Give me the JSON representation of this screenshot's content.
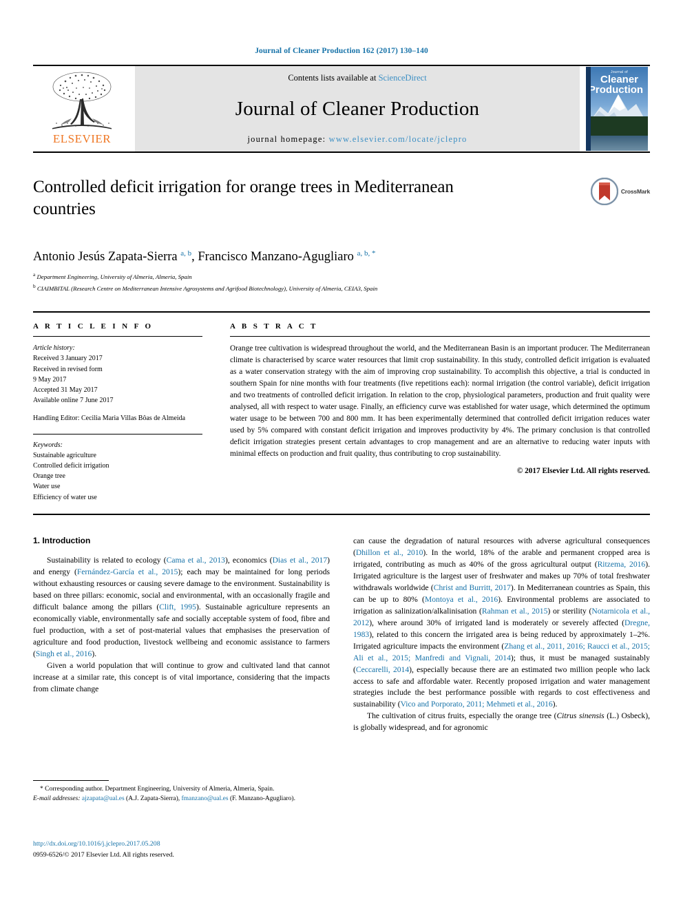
{
  "running_head": "Journal of Cleaner Production 162 (2017) 130–140",
  "masthead": {
    "publisher": "ELSEVIER",
    "contents_prefix": "Contents lists available at ",
    "contents_link": "ScienceDirect",
    "journal_name": "Journal of Cleaner Production",
    "homepage_prefix": "journal homepage: ",
    "homepage_url": "www.elsevier.com/locate/jclepro",
    "cover": {
      "line1": "Journal of",
      "line2": "Cleaner",
      "line3": "Production"
    }
  },
  "article": {
    "title": "Controlled deficit irrigation for orange trees in Mediterranean countries",
    "crossmark_label": "CrossMark",
    "authors_html": "Antonio Jesús Zapata-Sierra <sup>a, b</sup>, Francisco Manzano-Agugliaro <sup>a, b, *</sup>",
    "affiliations": [
      {
        "marker": "a",
        "text": "Department Engineering, University of Almeria, Almeria, Spain"
      },
      {
        "marker": "b",
        "text": "CIAIMBITAL (Research Centre on Mediterranean Intensive Agrosystems and Agrifood Biotechnology), University of Almeria, CEIA3, Spain"
      }
    ]
  },
  "info": {
    "heading": "A R T I C L E  I N F O",
    "history_label": "Article history:",
    "history": [
      "Received 3 January 2017",
      "Received in revised form",
      "9 May 2017",
      "Accepted 31 May 2017",
      "Available online 7 June 2017"
    ],
    "handling_editor": "Handling Editor: Cecilia Maria Villas Bôas de Almeida",
    "keywords_label": "Keywords:",
    "keywords": [
      "Sustainable agriculture",
      "Controlled deficit irrigation",
      "Orange tree",
      "Water use",
      "Efficiency of water use"
    ]
  },
  "abstract": {
    "heading": "A B S T R A C T",
    "text": "Orange tree cultivation is widespread throughout the world, and the Mediterranean Basin is an important producer. The Mediterranean climate is characterised by scarce water resources that limit crop sustainability. In this study, controlled deficit irrigation is evaluated as a water conservation strategy with the aim of improving crop sustainability. To accomplish this objective, a trial is conducted in southern Spain for nine months with four treatments (five repetitions each): normal irrigation (the control variable), deficit irrigation and two treatments of controlled deficit irrigation. In relation to the crop, physiological parameters, production and fruit quality were analysed, all with respect to water usage. Finally, an efficiency curve was established for water usage, which determined the optimum water usage to be between 700 and 800 mm. It has been experimentally determined that controlled deficit irrigation reduces water used by 5% compared with constant deficit irrigation and improves productivity by 4%. The primary conclusion is that controlled deficit irrigation strategies present certain advantages to crop management and are an alternative to reducing water inputs with minimal effects on production and fruit quality, thus contributing to crop sustainability.",
    "copyright": "© 2017 Elsevier Ltd. All rights reserved."
  },
  "introduction": {
    "heading": "1. Introduction",
    "left_paragraphs": [
      "Sustainability is related to ecology (<a class=\"cit\">Cama et al., 2013</a>), economics (<a class=\"cit\">Dias et al., 2017</a>) and energy (<a class=\"cit\">Fernández-García et al., 2015</a>); each may be maintained for long periods without exhausting resources or causing severe damage to the environment. Sustainability is based on three pillars: economic, social and environmental, with an occasionally fragile and difficult balance among the pillars (<a class=\"cit\">Clift, 1995</a>). Sustainable agriculture represents an economically viable, environmentally safe and socially acceptable system of food, fibre and fuel production, with a set of post-material values that emphasises the preservation of agriculture and food production, livestock wellbeing and economic assistance to farmers (<a class=\"cit\">Singh et al., 2016</a>).",
      "Given a world population that will continue to grow and cultivated land that cannot increase at a similar rate, this concept is of vital importance, considering that the impacts from climate change"
    ],
    "right_paragraphs": [
      "can cause the degradation of natural resources with adverse agricultural consequences (<a class=\"cit\">Dhillon et al., 2010</a>). In the world, 18% of the arable and permanent cropped area is irrigated, contributing as much as 40% of the gross agricultural output (<a class=\"cit\">Ritzema, 2016</a>). Irrigated agriculture is the largest user of freshwater and makes up 70% of total freshwater withdrawals worldwide (<a class=\"cit\">Christ and Burritt, 2017</a>). In Mediterranean countries as Spain, this can be up to 80% (<a class=\"cit\">Montoya et al., 2016</a>). Environmental problems are associated to irrigation as salinization/alkalinisation (<a class=\"cit\">Rahman et al., 2015</a>) or sterility (<a class=\"cit\">Notarnicola et al., 2012</a>), where around 30% of irrigated land is moderately or severely affected (<a class=\"cit\">Dregne, 1983</a>), related to this concern the irrigated area is being reduced by approximately 1–2%. Irrigated agriculture impacts the environment (<a class=\"cit\">Zhang et al., 2011, 2016; Raucci et al., 2015; Ali et al., 2015; Manfredi and Vignali, 2014</a>); thus, it must be managed sustainably (<a class=\"cit\">Ceccarelli, 2014</a>), especially because there are an estimated two million people who lack access to safe and affordable water. Recently proposed irrigation and water management strategies include the best performance possible with regards to cost effectiveness and sustainability (<a class=\"cit\">Vico and Porporato, 2011; Mehmeti et al., 2016</a>).",
      "The cultivation of citrus fruits, especially the orange tree (<i>Citrus sinensis</i> (L.) Osbeck), is globally widespread, and for agronomic"
    ]
  },
  "footnotes": {
    "corresponding": "* Corresponding author. Department Engineering, University of Almeria, Almeria, Spain.",
    "email_label": "E-mail addresses:",
    "email1": "ajzapata@ual.es",
    "email1_owner": "(A.J. Zapata-Sierra),",
    "email2": "fmanzano@ual.es",
    "email2_owner": "(F. Manzano-Agugliaro)."
  },
  "footer": {
    "doi": "http://dx.doi.org/10.1016/j.jclepro.2017.05.208",
    "issn_line": "0959-6526/© 2017 Elsevier Ltd. All rights reserved."
  },
  "colors": {
    "link": "#1672a8",
    "elsevier_orange": "#ef7622",
    "banner_gray": "#e4e4e4"
  }
}
